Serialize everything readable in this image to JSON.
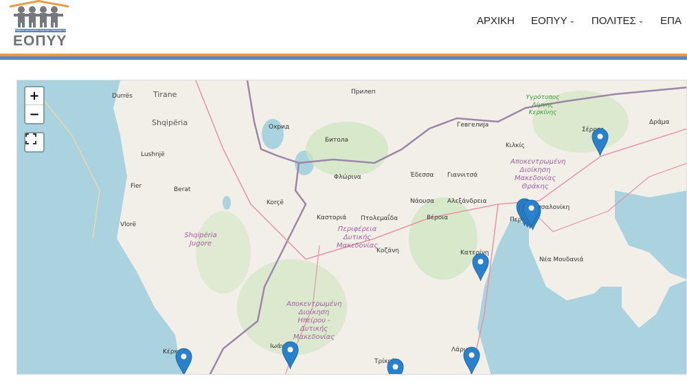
{
  "header": {
    "logo_text": "ΕΟΠΥΥ",
    "logo_subtitle": "ΕΘΝΙΚΟΣ ΟΡΓΑΝΙΣΜΟΣ ΠΑΡΟΧΗΣ ΥΠΗΡΕΣΙΩΝ ΥΓΕΙΑΣ",
    "nav": [
      {
        "label": "ΑΡΧΙΚΗ",
        "dropdown": false
      },
      {
        "label": "ΕΟΠΥΥ",
        "dropdown": true
      },
      {
        "label": "ΠΟΛΙΤΕΣ",
        "dropdown": true
      },
      {
        "label": "ΕΠΑ",
        "dropdown": false
      }
    ],
    "colors": {
      "orange": "#f0973b",
      "blue": "#5289c4"
    }
  },
  "map": {
    "controls": {
      "zoom_in": "+",
      "zoom_out": "−",
      "fullscreen": "fullscreen-icon"
    },
    "labels": {
      "durres": "Durrës",
      "tirane": "Tirane",
      "shqiperia": "Shqipëria",
      "lushnje": "Lushnjë",
      "fier": "Fier",
      "berat": "Berat",
      "vlore": "Vlorë",
      "korce": "Korçë",
      "shq_jugore": "Shqipëria Jugore",
      "ohrid": "Охрид",
      "prilep": "Прилеп",
      "bitola": "Битола",
      "gevgelija": "Гевгелија",
      "kerkini": "Υγρότοπος Λίμνης Κερκίνης",
      "serres": "Σέρρες",
      "drama": "Δράμα",
      "kilkis": "Κιλκίς",
      "adm_makedonias": "Αποκεντρωμένη Διοίκηση Μακεδονίας Θράκης",
      "edessa": "Έδεσσα",
      "giannitsa": "Γιαννιτσά",
      "florina": "Φλώρινα",
      "naousa": "Νάουσα",
      "alexandreia": "Αλεξάνδρεια",
      "thessaloniki": "Θεσσαλονίκη",
      "peraia": "Περαία",
      "kastoria": "Καστοριά",
      "ptolemaida": "Πτολεμαΐδα",
      "veroia": "Βέροια",
      "dytikis_mak": "Περιφέρεια Δυτικής Μακεδονίας",
      "kozani": "Κοζάνη",
      "katerini": "Κατερίνη",
      "moudania": "Νέα Μουδανιά",
      "adm_ipeirou": "Αποκεντρωμένη Διοίκηση Ηπείρου - Δυτικής Μακεδονίας",
      "ioannina": "Ιωάννινα",
      "kerkyra": "Κέρκυρα",
      "trikala": "Τρίκαλα",
      "larisa": "Λάρισα"
    },
    "marker_color": "#2a81cb"
  }
}
